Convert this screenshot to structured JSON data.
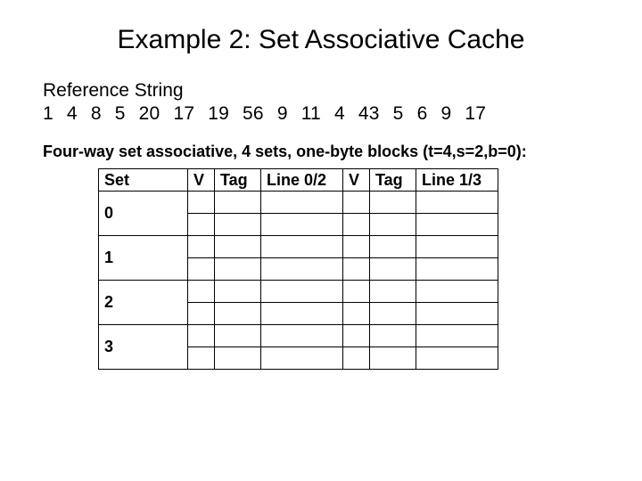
{
  "title": "Example 2: Set Associative Cache",
  "ref_label": "Reference String",
  "ref_string": "1 4 8 5 20 17 19 56 9 11 4 43 5 6 9 17",
  "desc": "Four-way set associative, 4 sets, one-byte blocks (t=4,s=2,b=0):",
  "headers": {
    "set": "Set",
    "v1": "V",
    "tag1": "Tag",
    "line02": "Line 0/2",
    "v2": "V",
    "tag2": "Tag",
    "line13": "Line 1/3"
  },
  "rows": [
    {
      "set": "0",
      "v1": "",
      "tag1": "",
      "line02": "",
      "v2": "",
      "tag2": "",
      "line13": "",
      "sub": [
        "",
        "",
        "",
        "",
        "",
        ""
      ]
    },
    {
      "set": "1",
      "v1": "",
      "tag1": "",
      "line02": "",
      "v2": "",
      "tag2": "",
      "line13": "",
      "sub": [
        "",
        "",
        "",
        "",
        "",
        ""
      ]
    },
    {
      "set": "2",
      "v1": "",
      "tag1": "",
      "line02": "",
      "v2": "",
      "tag2": "",
      "line13": "",
      "sub": [
        "",
        "",
        "",
        "",
        "",
        ""
      ]
    },
    {
      "set": "3",
      "v1": "",
      "tag1": "",
      "line02": "",
      "v2": "",
      "tag2": "",
      "line13": "",
      "sub": [
        "",
        "",
        "",
        "",
        "",
        ""
      ]
    }
  ]
}
